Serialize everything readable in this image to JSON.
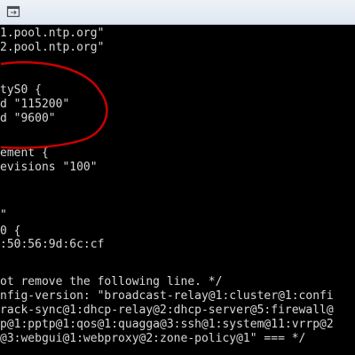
{
  "window": {
    "title_icon": "maximize-icon"
  },
  "terminal": {
    "lines": [
      "1.pool.ntp.org\"",
      "2.pool.ntp.org\"",
      "",
      "",
      "tyS0 {",
      "d \"115200\"",
      "d \"9600\"",
      "",
      "",
      "ement {",
      "evisions \"100\"",
      "",
      "",
      "\"",
      "0 {",
      ":50:56:9d:6c:cf",
      "",
      "",
      "ot remove the following line. */",
      "nfig-version: \"broadcast-relay@1:cluster@1:confi",
      "rack-sync@1:dhcp-relay@2:dhcp-server@5:firewall@",
      "p@1:pptp@1:qos@1:quagga@3:ssh@1:system@11:vrrp@2",
      "@3:webgui@1:webproxy@2:zone-policy@1\" === */"
    ]
  },
  "annotation": {
    "color": "#cc0000"
  }
}
